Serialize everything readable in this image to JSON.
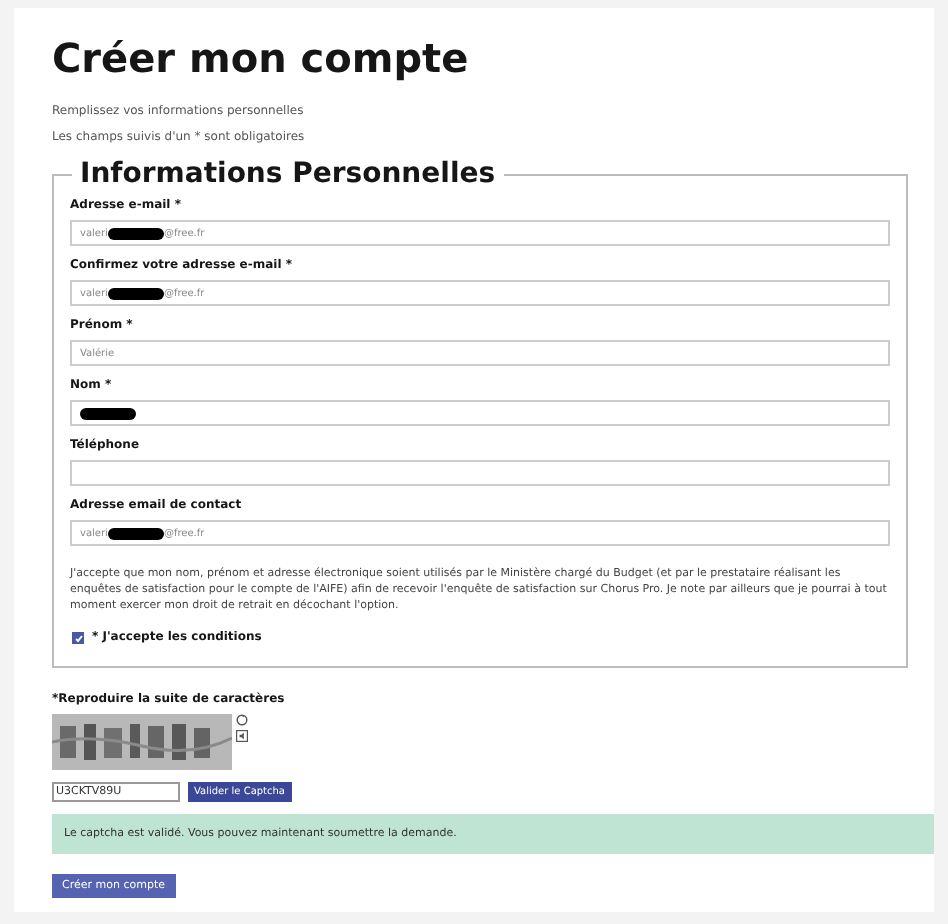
{
  "title": "Créer mon compte",
  "intro": [
    "Remplissez vos informations personnelles",
    "Les champs suivis d'un * sont obligatoires"
  ],
  "fieldset": {
    "legend": "Informations Personnelles",
    "fields": [
      {
        "label": "Adresse e-mail *",
        "value_start": "valeri",
        "redacted": true,
        "value_end": "@free.fr"
      },
      {
        "label": "Confirmez votre adresse e-mail *",
        "value_start": "valeri",
        "redacted": true,
        "value_end": "@free.fr"
      },
      {
        "label": "Prénom *",
        "value_start": "Valérie",
        "redacted": false
      },
      {
        "label": "Nom *",
        "redacted": true
      },
      {
        "label": "Téléphone",
        "redacted": false
      },
      {
        "label": "Adresse email de contact",
        "value_start": "valeri",
        "redacted": true,
        "value_end": "@free.fr"
      }
    ],
    "consent_text": "J'accepte que mon nom, prénom et adresse électronique soient utilisés par le Ministère chargé du Budget (et par le prestataire réalisant les enquêtes de satisfaction pour le compte de l'AIFE) afin de recevoir l'enquête de satisfaction sur Chorus Pro. Je note par ailleurs que je pourrai à tout moment exercer mon droit de retrait en décochant l'option.",
    "checkbox": {
      "label": "* J'accepte les conditions",
      "checked": true
    }
  },
  "captcha": {
    "label": "*Reproduire la suite de caractères",
    "value": "U3CKTV89U",
    "button": "Valider le Captcha"
  },
  "alert": "Le captcha est validé. Vous pouvez maintenant soumettre la demande.",
  "submit": "Créer mon compte"
}
